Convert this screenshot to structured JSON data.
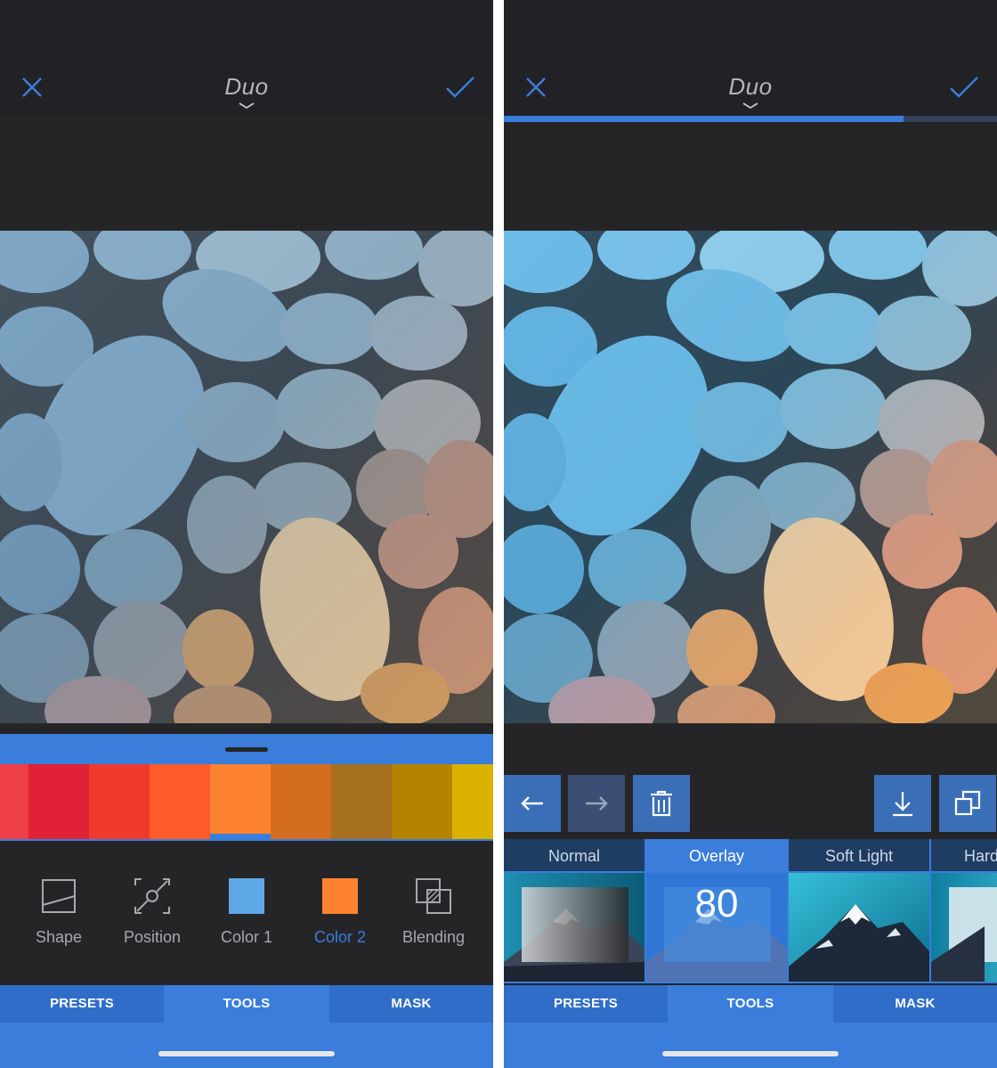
{
  "left": {
    "nav": {
      "title": "Duo"
    },
    "color_strip": [
      "#ee3e46",
      "#e12135",
      "#ef3a2d",
      "#fe5a2c",
      "#fd8330",
      "#d56d20",
      "#a77021",
      "#b58300",
      "#dbb100"
    ],
    "selected_swatch_index": 4,
    "tools": [
      {
        "label": "Shape",
        "icon": "shape-icon"
      },
      {
        "label": "Position",
        "icon": "position-icon"
      },
      {
        "label": "Color 1",
        "icon": "color1-swatch-icon"
      },
      {
        "label": "Color 2",
        "icon": "color2-swatch-icon"
      },
      {
        "label": "Blending",
        "icon": "blending-icon"
      }
    ],
    "active_tool_index": 3,
    "tabs": [
      "PRESETS",
      "TOOLS",
      "MASK"
    ],
    "active_tab_index": 1
  },
  "right": {
    "nav": {
      "title": "Duo"
    },
    "progress": 0.81,
    "actions": [
      "undo-arrow-icon",
      "redo-arrow-icon",
      "trash-icon",
      "download-icon",
      "duplicate-icon"
    ],
    "blend_modes": [
      {
        "label": "Normal"
      },
      {
        "label": "Overlay",
        "value": "80"
      },
      {
        "label": "Soft Light"
      },
      {
        "label": "Hard"
      }
    ],
    "active_mode_index": 1,
    "tabs": [
      "PRESETS",
      "TOOLS",
      "MASK"
    ],
    "active_tab_index": 1
  },
  "colors": {
    "accent": "#3a7ddb",
    "background": "#252528",
    "color1": "#5fa8e6",
    "color2": "#fd8330"
  }
}
